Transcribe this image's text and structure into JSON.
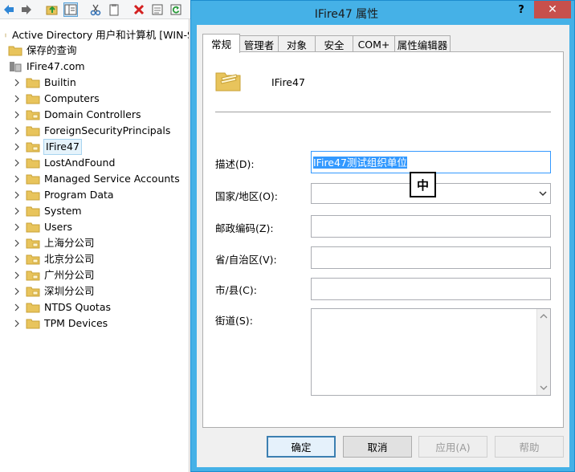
{
  "toolbar": {
    "buttons": [
      "back-arrow-icon",
      "forward-arrow-icon",
      "folder-up-icon",
      "show-hide-tree-icon",
      "cut-icon",
      "copy-icon",
      "delete-icon",
      "properties-icon",
      "refresh-icon"
    ]
  },
  "tree": {
    "root": "Active Directory 用户和计算机 [WIN-SFD",
    "saved_queries": "保存的查询",
    "domain": "IFire47.com",
    "items": [
      {
        "label": "Builtin"
      },
      {
        "label": "Computers"
      },
      {
        "label": "Domain Controllers"
      },
      {
        "label": "ForeignSecurityPrincipals"
      },
      {
        "label": "IFire47"
      },
      {
        "label": "LostAndFound"
      },
      {
        "label": "Managed Service Accounts"
      },
      {
        "label": "Program Data"
      },
      {
        "label": "System"
      },
      {
        "label": "Users"
      },
      {
        "label": "上海分公司"
      },
      {
        "label": "北京分公司"
      },
      {
        "label": "广州分公司"
      },
      {
        "label": "深圳分公司"
      },
      {
        "label": "NTDS Quotas"
      },
      {
        "label": "TPM Devices"
      }
    ]
  },
  "dialog": {
    "title": "IFire47 属性",
    "help": "?",
    "close": "✕",
    "tabs": [
      "常规",
      "管理者",
      "对象",
      "安全",
      "COM+",
      "属性编辑器"
    ],
    "object_name": "IFire47",
    "fields": {
      "description_label": "描述(D):",
      "description_value": "IFire47测试组织单位",
      "country_label": "国家/地区(O):",
      "country_value": "",
      "zip_label": "邮政编码(Z):",
      "zip_value": "",
      "province_label": "省/自治区(V):",
      "province_value": "",
      "city_label": "市/县(C):",
      "city_value": "",
      "street_label": "街道(S):",
      "street_value": ""
    },
    "ime_indicator": "中",
    "buttons": {
      "ok": "确定",
      "cancel": "取消",
      "apply": "应用(A)",
      "help": "帮助"
    }
  },
  "colors": {
    "dialog_frame": "#45b1e7",
    "close_button": "#c7504c",
    "selection": "#3399ff",
    "folder": "#e8c45c"
  }
}
